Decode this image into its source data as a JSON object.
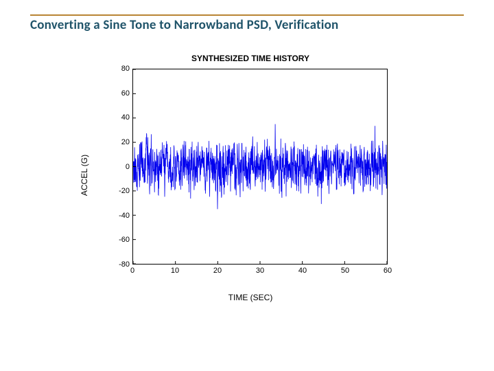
{
  "page_title": "Converting a Sine Tone to Narrowband PSD, Verification",
  "chart_data": {
    "type": "line",
    "title": "SYNTHESIZED TIME HISTORY",
    "xlabel": "TIME (SEC)",
    "ylabel": "ACCEL (G)",
    "xlim": [
      0,
      60
    ],
    "ylim": [
      -80,
      80
    ],
    "x_ticks": [
      0,
      10,
      20,
      30,
      40,
      50,
      60
    ],
    "y_ticks": [
      -80,
      -60,
      -40,
      -20,
      0,
      20,
      40,
      60,
      80
    ],
    "series_description": "Dense noisy random time-history trace, roughly zero-mean, amplitude mostly within ±20 with occasional spikes to about ±30–35, spanning 0–60 sec.",
    "series_stats": {
      "mean": 0,
      "typical_abs": 15,
      "max_abs": 35
    },
    "color": "#0000ee"
  }
}
